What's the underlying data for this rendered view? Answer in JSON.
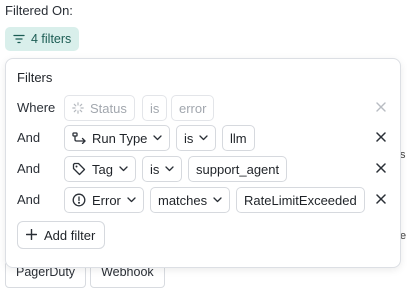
{
  "header": {
    "filtered_on_label": "Filtered On:"
  },
  "filters_pill": {
    "label": "4 filters"
  },
  "panel": {
    "title": "Filters",
    "rows": [
      {
        "conjunction": "Where",
        "field": "Status",
        "field_icon": "spinner-icon",
        "operator": "is",
        "value": "error",
        "disabled": true
      },
      {
        "conjunction": "And",
        "field": "Run Type",
        "field_icon": "run-type-icon",
        "operator": "is",
        "value": "llm",
        "disabled": false
      },
      {
        "conjunction": "And",
        "field": "Tag",
        "field_icon": "tag-icon",
        "operator": "is",
        "value": "support_agent",
        "disabled": false
      },
      {
        "conjunction": "And",
        "field": "Error",
        "field_icon": "alert-circle-icon",
        "operator": "matches",
        "value": "RateLimitExceeded",
        "disabled": false
      }
    ],
    "add_filter_label": "Add filter"
  },
  "background": {
    "tabs": [
      "PagerDuty",
      "Webhook"
    ],
    "edge_glyph_1": "s",
    "edge_glyph_2": "e"
  },
  "colors": {
    "accent_bg": "#d9efeb",
    "accent_text": "#1b5c53"
  }
}
